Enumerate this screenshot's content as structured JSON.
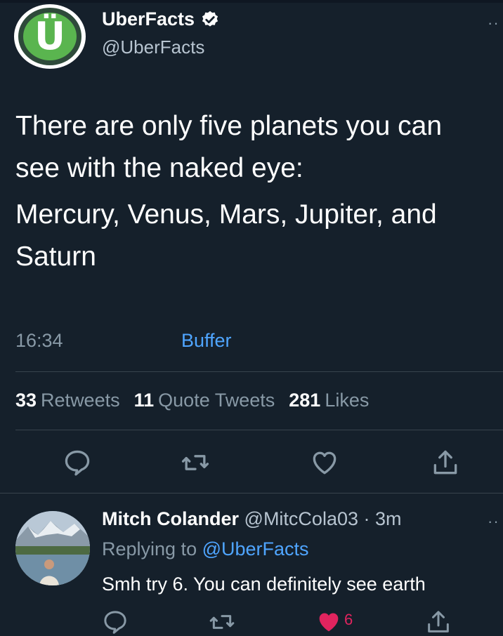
{
  "tweet": {
    "author_name": "UberFacts",
    "author_handle": "@UberFacts",
    "avatar_letter": "Ü",
    "text_lines": [
      "There are only five planets you can see with the naked eye:",
      "Mercury, Venus, Mars, Jupiter, and Saturn"
    ],
    "time": "16:34",
    "source": "Buffer",
    "more_glyph": "··"
  },
  "stats": {
    "retweets_count": "33",
    "retweets_label": "Retweets",
    "quotes_count": "11",
    "quotes_label": "Quote Tweets",
    "likes_count": "281",
    "likes_label": "Likes"
  },
  "actions": [
    "reply-icon",
    "retweet-icon",
    "like-icon",
    "share-icon"
  ],
  "reply": {
    "author_name": "Mitch Colander",
    "author_handle": "@MitcCola03",
    "separator": " · ",
    "age": "3m",
    "replying_prefix": "Replying to ",
    "replying_to": "@UberFacts",
    "text": "Smh try 6. You can definitely see earth",
    "like_count": "6",
    "more_glyph": "··"
  },
  "colors": {
    "background": "#15202b",
    "link": "#4fa5ff",
    "muted": "#8899a6",
    "like": "#e0245e",
    "divider": "#38444d"
  }
}
